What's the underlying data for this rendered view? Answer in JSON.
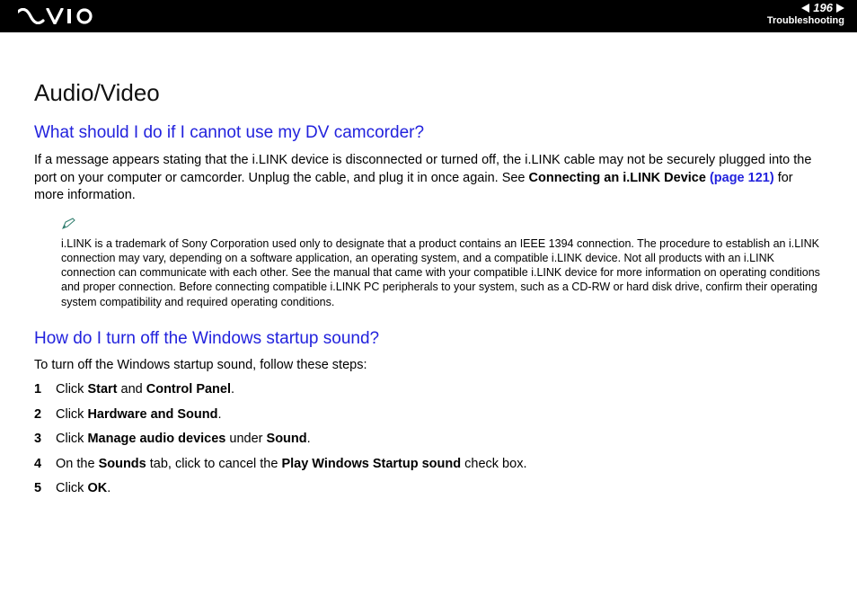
{
  "header": {
    "page_number": "196",
    "section": "Troubleshooting"
  },
  "content": {
    "title": "Audio/Video",
    "q1": {
      "heading": "What should I do if I cannot use my DV camcorder?",
      "p1_a": "If a message appears stating that the i.LINK device is disconnected or turned off, the i.LINK cable may not be securely plugged into the port on your computer or camcorder. Unplug the cable, and plug it in once again. See ",
      "p1_bold": "Connecting an i.LINK Device ",
      "p1_link": "(page 121)",
      "p1_b": " for more information.",
      "note": "i.LINK is a trademark of Sony Corporation used only to designate that a product contains an IEEE 1394 connection. The procedure to establish an i.LINK connection may vary, depending on a software application, an operating system, and a compatible i.LINK device. Not all products with an i.LINK connection can communicate with each other. See the manual that came with your compatible i.LINK device for more information on operating conditions and proper connection. Before connecting compatible i.LINK PC peripherals to your system, such as a CD-RW or hard disk drive, confirm their operating system compatibility and required operating conditions."
    },
    "q2": {
      "heading": "How do I turn off the Windows startup sound?",
      "intro": "To turn off the Windows startup sound, follow these steps:",
      "steps": [
        {
          "a": "Click ",
          "b1": "Start",
          "mid": " and ",
          "b2": "Control Panel",
          "end": "."
        },
        {
          "a": "Click ",
          "b1": "Hardware and Sound",
          "end": "."
        },
        {
          "a": "Click ",
          "b1": "Manage audio devices",
          "mid": " under ",
          "b2": "Sound",
          "end": "."
        },
        {
          "a": "On the ",
          "b1": "Sounds",
          "mid": " tab, click to cancel the ",
          "b2": "Play Windows Startup sound",
          "end": " check box."
        },
        {
          "a": "Click ",
          "b1": "OK",
          "end": "."
        }
      ]
    }
  }
}
